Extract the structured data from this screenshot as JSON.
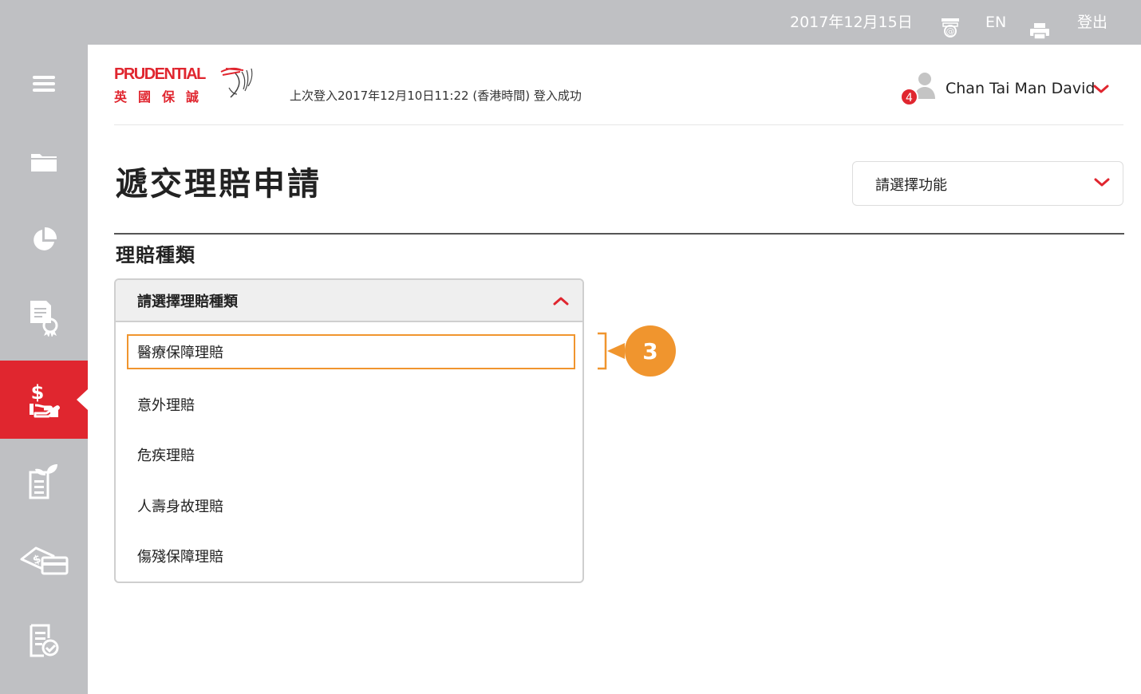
{
  "topbar": {
    "date": "2017年12月15日",
    "contact_icon": "contact-email-icon",
    "language": "EN",
    "print_icon": "print-icon",
    "logout": "登出"
  },
  "sidebar": {
    "items": [
      {
        "icon": "menu-icon",
        "active": false
      },
      {
        "icon": "folder-icon",
        "active": false
      },
      {
        "icon": "pie-chart-icon",
        "active": false
      },
      {
        "icon": "certificate-icon",
        "active": false
      },
      {
        "icon": "claim-dollar-hand-icon",
        "active": true
      },
      {
        "icon": "growth-document-icon",
        "active": false
      },
      {
        "icon": "money-card-icon",
        "active": false
      },
      {
        "icon": "checked-document-icon",
        "active": false
      }
    ]
  },
  "header": {
    "logo_word": "PRUDENTIAL",
    "logo_cn": "英國保誠",
    "last_login": "上次登入2017年12月10日11:22 (香港時間) 登入成功",
    "notification_count": "4",
    "user_name": "Chan Tai Man David"
  },
  "main": {
    "page_title": "遞交理賠申請",
    "function_select": {
      "placeholder": "請選擇功能"
    },
    "section_title": "理賠種類",
    "claim_dropdown": {
      "placeholder": "請選擇理賠種類",
      "expanded": true,
      "options": [
        "醫療保障理賠",
        "意外理賠",
        "危疾理賠",
        "人壽身故理賠",
        "傷殘保障理賠"
      ],
      "highlighted_index": 0
    },
    "callout_step": "3"
  },
  "colors": {
    "brand_red": "#e0262f",
    "sidebar_grey": "#bfc0c3",
    "highlight_orange": "#f0952e"
  }
}
